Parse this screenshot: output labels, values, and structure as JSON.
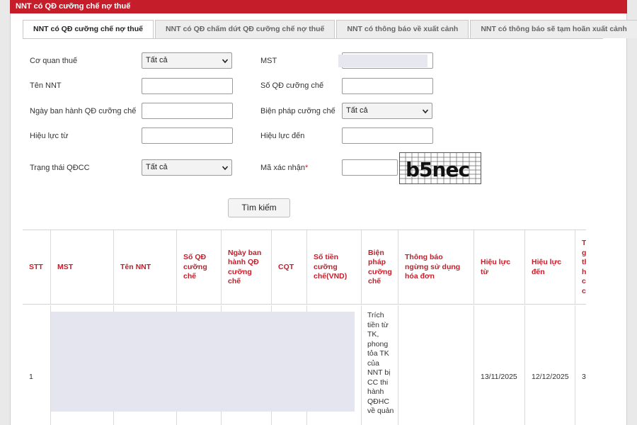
{
  "header": {
    "title": "NNT có QĐ cưỡng chế nợ thuế"
  },
  "tabs": [
    {
      "label": "NNT có QĐ cưỡng chế nợ thuế",
      "active": true
    },
    {
      "label": "NNT có QĐ chấm dứt QĐ cưỡng chế nợ thuế",
      "active": false
    },
    {
      "label": "NNT có thông báo về xuất cảnh",
      "active": false
    },
    {
      "label": "NNT có thông báo sẽ tạm hoãn xuất cảnh",
      "active": false
    }
  ],
  "form": {
    "co_quan_thue": {
      "label": "Cơ quan thuế",
      "value": "Tất cả"
    },
    "mst": {
      "label": "MST"
    },
    "ten_nnt": {
      "label": "Tên NNT"
    },
    "so_qd": {
      "label": "Số QĐ cưỡng chế"
    },
    "ngay_ban_hanh": {
      "label": "Ngày ban hành QĐ cưỡng chế"
    },
    "bien_phap": {
      "label": "Biện pháp cưỡng chế",
      "value": "Tất cả"
    },
    "hieu_luc_tu": {
      "label": "Hiệu lực từ"
    },
    "hieu_luc_den": {
      "label": "Hiệu lực đến"
    },
    "trang_thai": {
      "label": "Trạng thái QĐCC",
      "value": "Tất cả"
    },
    "ma_xac_nhan": {
      "label": "Mã xác nhận",
      "required_mark": "*"
    },
    "captcha_text": "b5nec",
    "search_button": "Tìm kiếm"
  },
  "table": {
    "headers": [
      "STT",
      "MST",
      "Tên NNT",
      "Số QĐ cưỡng chế",
      "Ngày ban hành QĐ cưỡng chế",
      "CQT",
      "Số tiền cưỡng chế(VND)",
      "Biện pháp cưỡng chế",
      "Thông báo ngừng sử dụng hóa đơn",
      "Hiệu lực từ",
      "Hiệu lực đến",
      "T g th h c c"
    ],
    "rows": [
      {
        "stt": "1",
        "bien_phap": "Trích tiền từ TK, phong tỏa TK của NNT bị CC thi hành QĐHC về quản",
        "hieu_luc_tu": "13/11/2025",
        "hieu_luc_den": "12/12/2025",
        "last_col": "3"
      }
    ]
  },
  "colors": {
    "accent": "#c51d2a",
    "header_text": "#ffffff"
  }
}
